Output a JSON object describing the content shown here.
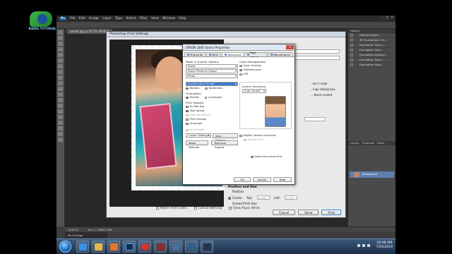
{
  "photoshop": {
    "logo": "Ps",
    "menu": [
      "File",
      "Edit",
      "Image",
      "Layer",
      "Type",
      "Select",
      "Filter",
      "View",
      "Window",
      "Help"
    ],
    "document_tab": "amaal.jpg @ 16.7% (RGB/8)",
    "status_zoom": "16.67%",
    "status_doc": "Doc: 2.18M/2.18M",
    "mini_bridge": "Mini Bridge",
    "history_header": "History",
    "history_items": [
      "Default Actions",
      "3D Foundations Crit...",
      "Foundation Tyles 3...",
      "Foundation Tyles...",
      "Foundation Setting t...",
      "Foundation Tyles t...",
      "Foundation Tubal..."
    ],
    "layers_tabs": [
      "Layers",
      "Channels",
      "Paths"
    ],
    "layer_name": "Background"
  },
  "print_dialog": {
    "title": "Photoshop Print Settings",
    "match_print_colors": "Match Print Colors",
    "gamut_warning": "Gamut Warning",
    "show_paper_white": "Show Paper White",
    "right_snippets": [
      "...ter's color",
      "...ings dialog box.",
      "... black scaled"
    ],
    "position_title": "Position and Size",
    "position_label": "Position",
    "center_label": "Center",
    "top_label": "Top:",
    "top_value": "4.008",
    "left_label": "Left:",
    "left_value": "1.026",
    "scaled_label": "Scaled Print Size",
    "buttons": {
      "cancel": "Cancel",
      "done": "Done",
      "print": "Print"
    }
  },
  "epson": {
    "title": "EPSON L800 Series Properties",
    "tabs": [
      "Shortcuts",
      "Main",
      "Advanced",
      "Page Layout",
      "Maintenance"
    ],
    "active_tab": "Advanced",
    "paper_quality_label": "Paper & Quality Options",
    "paper_source": "Sheet",
    "paper_type": "Epson Premium Glossy",
    "quality": "Photo",
    "paper_size": "4 x 6 in (10 x 15 cm)",
    "borders": "Borders",
    "borderless": "Borderless",
    "orientation_label": "Orientation",
    "portrait": "Portrait",
    "landscape": "Landscape",
    "print_options_label": "Print Options",
    "print_options": [
      {
        "label": "Fix Red-Eye",
        "checked": false,
        "disabled": false
      },
      {
        "label": "High Speed",
        "checked": true,
        "disabled": false
      },
      {
        "label": "Edge Smoothing",
        "checked": false,
        "disabled": true
      },
      {
        "label": "Print Preview",
        "checked": false,
        "disabled": false
      },
      {
        "label": "Grayscale",
        "checked": false,
        "disabled": false
      }
    ],
    "quiet_mode": "Quiet Mode",
    "custom_settings": "Custom Settings",
    "save_settings": "Save Settings...",
    "reset_defaults": "Reset Defaults",
    "technical_support": "Technical Support",
    "color_mgmt_label": "Color Management",
    "color_controls": "Color Controls",
    "photoenhance": "PhotoEnhance",
    "icm": "ICM",
    "scene_correction": "Scene Correction",
    "auto_correct": "Auto Correct",
    "digital_camera": "Digital Camera Correction",
    "smooth_skin": "Smooth Skin",
    "show_screen_first": "Show this screen first",
    "ok": "OK",
    "cancel": "Cancel",
    "help": "Help"
  },
  "taskbar": {
    "time": "10:48 AM",
    "date": "7/25/2019"
  },
  "channel_logo_text": "BIANG TUTORIAL"
}
